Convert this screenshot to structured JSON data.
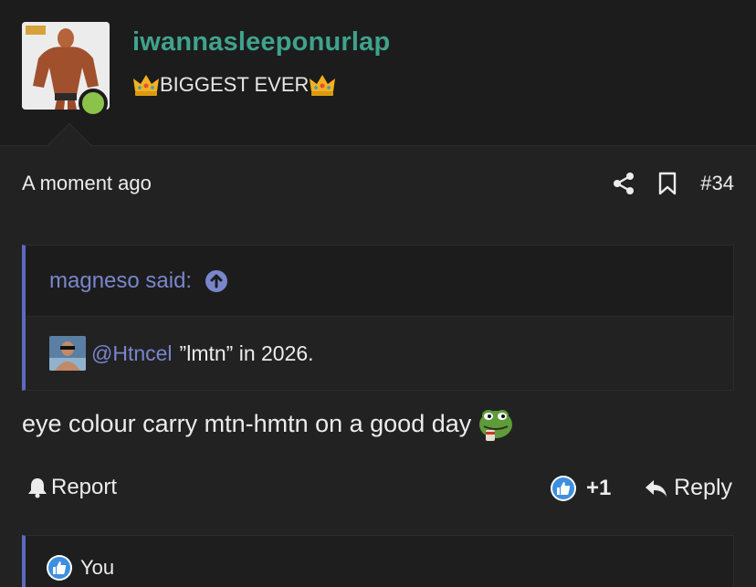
{
  "user": {
    "username": "iwannasleeponurlap",
    "title": "BIGGEST EVER",
    "online": true
  },
  "post": {
    "time": "A moment ago",
    "number": "#34"
  },
  "quote": {
    "author": "magneso said:",
    "mention": "@Htncel",
    "text": "”lmtn” in 2026."
  },
  "message": {
    "text": "eye colour carry mtn-hmtn on a good day"
  },
  "footer": {
    "report_label": "Report",
    "reaction_count": "+1",
    "reply_label": "Reply"
  },
  "reaction_list": {
    "user": "You"
  },
  "colors": {
    "username": "#3fa38c",
    "quote_accent": "#5c6bc0",
    "link": "#7986cb",
    "online": "#8bc34a",
    "like_blue": "#3d8fe0"
  },
  "icons": [
    "crown-icon",
    "share-icon",
    "bookmark-icon",
    "arrow-up-circle-icon",
    "frog-emoji",
    "bell-icon",
    "like-icon",
    "reply-icon"
  ]
}
